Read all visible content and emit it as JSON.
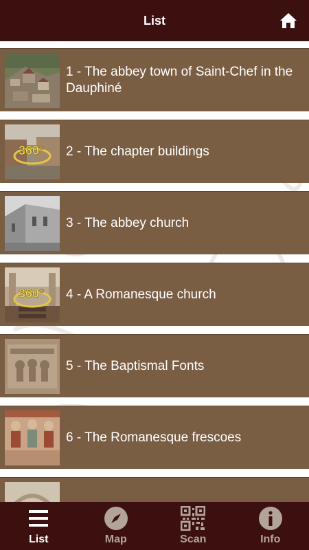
{
  "header": {
    "title": "List",
    "home_icon": "home-icon"
  },
  "colors": {
    "bar": "#3d1010",
    "row": "#7a5e44",
    "inactive": "#b3a49a"
  },
  "items": [
    {
      "label": "1 - The abbey town of Saint-Chef in the Dauphiné",
      "thumb": "town-aerial-photo"
    },
    {
      "label": "2 - The chapter buildings",
      "thumb": "360-panorama-courtyard",
      "badge": "360°"
    },
    {
      "label": "3 - The abbey church",
      "thumb": "church-exterior-photo"
    },
    {
      "label": "4 - A Romanesque church",
      "thumb": "360-panorama-nave",
      "badge": "360°"
    },
    {
      "label": "5 - The Baptismal Fonts",
      "thumb": "carved-stone-photo"
    },
    {
      "label": "6 - The Romanesque frescoes",
      "thumb": "fresco-photo"
    },
    {
      "label": "",
      "thumb": "interior-photo"
    }
  ],
  "nav": [
    {
      "label": "List",
      "icon": "list-icon",
      "active": true
    },
    {
      "label": "Map",
      "icon": "compass-icon",
      "active": false
    },
    {
      "label": "Scan",
      "icon": "qr-code-icon",
      "active": false
    },
    {
      "label": "Info",
      "icon": "info-icon",
      "active": false
    }
  ]
}
